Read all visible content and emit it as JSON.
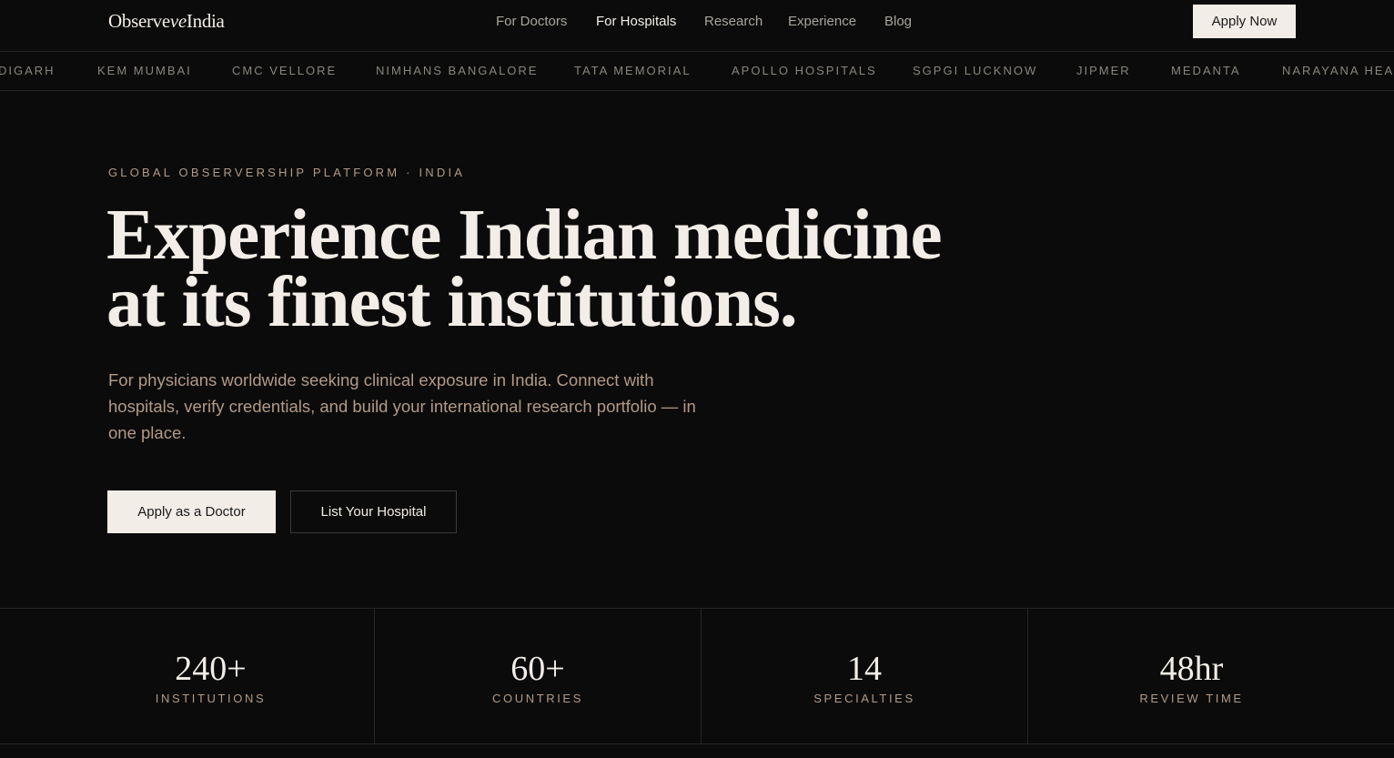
{
  "nav": {
    "logo_pre": "Observe",
    "logo_em": "ve",
    "logo_mid": "",
    "logo_post": "India",
    "links": [
      {
        "label": "For Doctors",
        "active": false
      },
      {
        "label": "For Hospitals",
        "active": true
      },
      {
        "label": "Research",
        "active": false
      },
      {
        "label": "Experience",
        "active": false
      },
      {
        "label": "Blog",
        "active": false
      }
    ],
    "cta": "Apply Now"
  },
  "ticker": [
    "DIGARH",
    "KEM MUMBAI",
    "CMC VELLORE",
    "NIMHANS BANGALORE",
    "TATA MEMORIAL",
    "APOLLO HOSPITALS",
    "SGPGI LUCKNOW",
    "JIPMER",
    "MEDANTA",
    "NARAYANA HEAL"
  ],
  "hero": {
    "eyebrow": "GLOBAL OBSERVERSHIP PLATFORM · INDIA",
    "headline_line1": "Experience Indian medicine",
    "headline_line2": "at its finest institutions.",
    "lede": "For physicians worldwide seeking clinical exposure in India. Connect with hospitals, verify credentials, and build your international research portfolio — in one place.",
    "primary_cta": "Apply as a Doctor",
    "secondary_cta": "List Your Hospital"
  },
  "stats": [
    {
      "value": "240+",
      "label": "INSTITUTIONS"
    },
    {
      "value": "60+",
      "label": "COUNTRIES"
    },
    {
      "value": "14",
      "label": "SPECIALTIES"
    },
    {
      "value": "48hr",
      "label": "REVIEW TIME"
    }
  ]
}
